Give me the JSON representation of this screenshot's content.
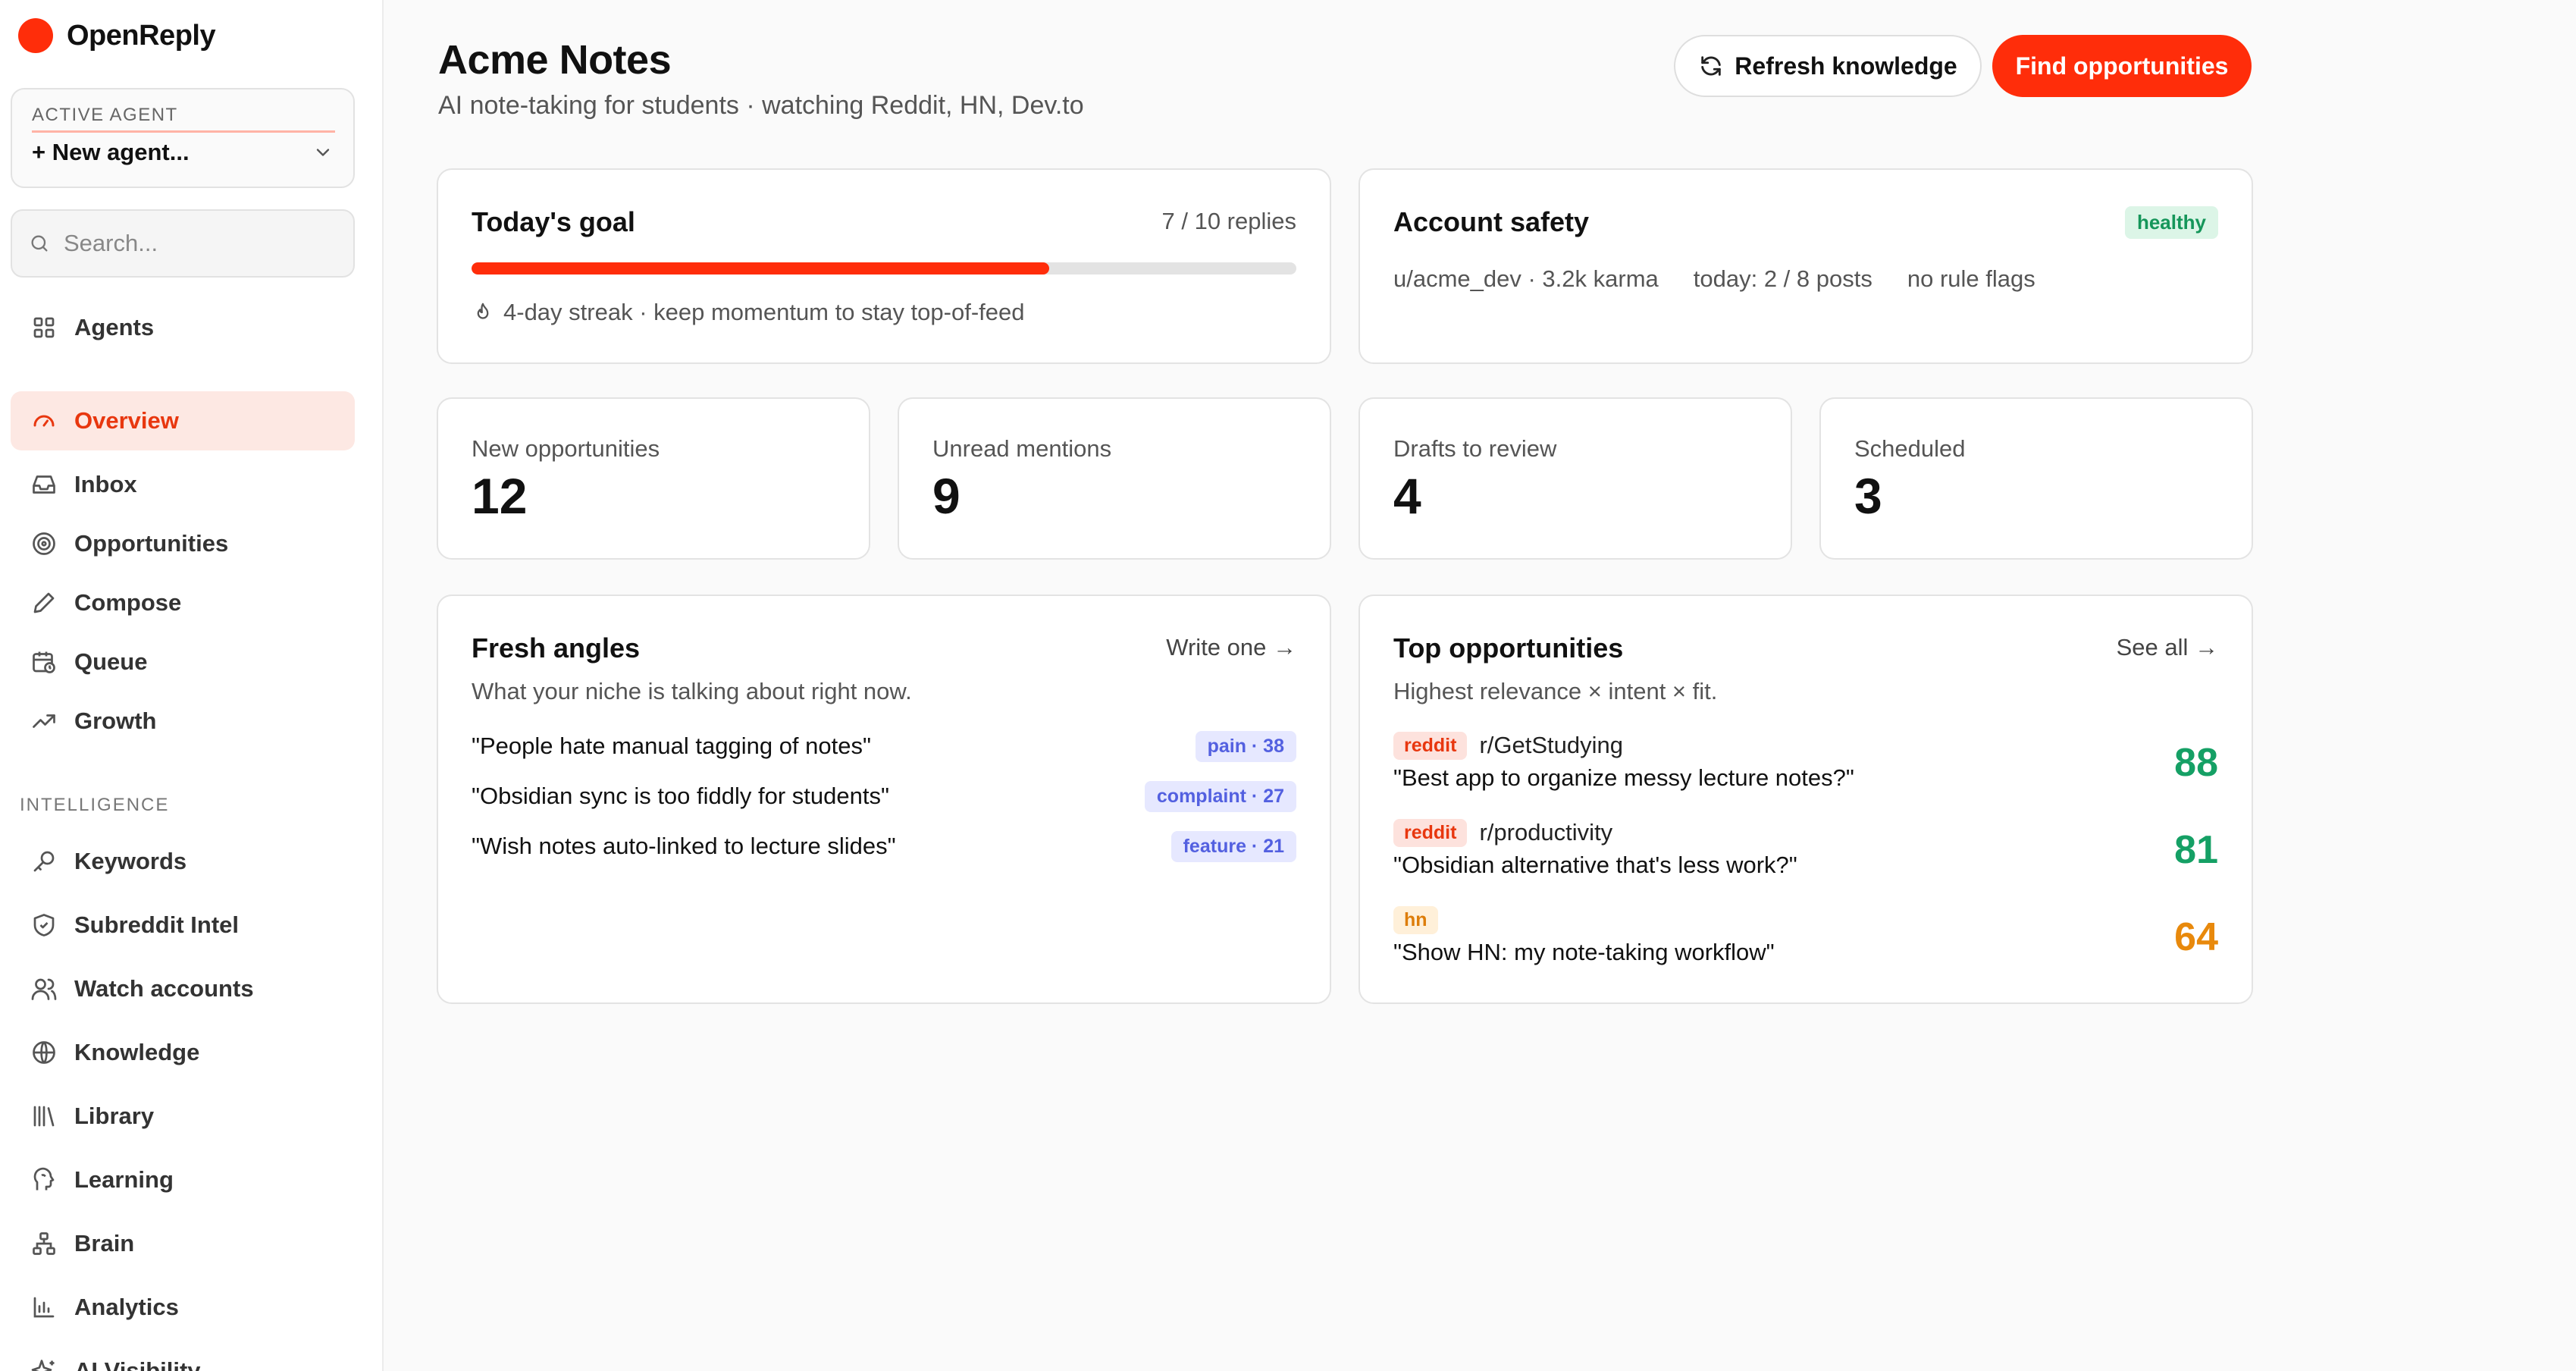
{
  "app": {
    "name": "OpenReply",
    "brand_color": "#ff2d0a"
  },
  "agent": {
    "label": "ACTIVE AGENT",
    "value": "+ New agent..."
  },
  "search": {
    "placeholder": "Search..."
  },
  "nav": {
    "top": [
      {
        "label": "Agents",
        "icon": "grid-icon"
      }
    ],
    "main": [
      {
        "label": "Overview",
        "icon": "gauge-icon",
        "active": true
      },
      {
        "label": "Inbox",
        "icon": "inbox-icon"
      },
      {
        "label": "Opportunities",
        "icon": "target-icon"
      },
      {
        "label": "Compose",
        "icon": "pen-icon"
      },
      {
        "label": "Queue",
        "icon": "calendar-clock-icon"
      },
      {
        "label": "Growth",
        "icon": "trend-up-icon"
      }
    ],
    "intelligence_label": "INTELLIGENCE",
    "intelligence": [
      {
        "label": "Keywords",
        "icon": "key-icon"
      },
      {
        "label": "Subreddit Intel",
        "icon": "shield-icon"
      },
      {
        "label": "Watch accounts",
        "icon": "users-icon"
      },
      {
        "label": "Knowledge",
        "icon": "globe-icon"
      },
      {
        "label": "Library",
        "icon": "library-icon"
      },
      {
        "label": "Learning",
        "icon": "brain-head-icon"
      },
      {
        "label": "Brain",
        "icon": "network-icon"
      },
      {
        "label": "Analytics",
        "icon": "bar-chart-icon"
      },
      {
        "label": "AI Visibility",
        "icon": "sparkles-icon"
      }
    ]
  },
  "header": {
    "title": "Acme Notes",
    "subtitle": "AI note-taking for students · watching Reddit, HN, Dev.to",
    "refresh_label": "Refresh knowledge",
    "find_label": "Find opportunities"
  },
  "goal": {
    "title": "Today's goal",
    "count": "7 / 10 replies",
    "progress": 0.7,
    "streak": "4-day streak · keep momentum to stay top-of-feed"
  },
  "safety": {
    "title": "Account safety",
    "badge": "healthy",
    "account": "u/acme_dev · 3.2k karma",
    "today": "today: 2 / 8 posts",
    "flags": "no rule flags"
  },
  "stats": [
    {
      "label": "New opportunities",
      "value": "12"
    },
    {
      "label": "Unread mentions",
      "value": "9"
    },
    {
      "label": "Drafts to review",
      "value": "4"
    },
    {
      "label": "Scheduled",
      "value": "3"
    }
  ],
  "angles": {
    "title": "Fresh angles",
    "link": "Write one →",
    "desc": "What your niche is talking about right now.",
    "items": [
      {
        "text": "\"People hate manual tagging of notes\"",
        "tag": "pain · 38"
      },
      {
        "text": "\"Obsidian sync is too fiddly for students\"",
        "tag": "complaint · 27"
      },
      {
        "text": "\"Wish notes auto-linked to lecture slides\"",
        "tag": "feature · 21"
      }
    ]
  },
  "top_opps": {
    "title": "Top opportunities",
    "link": "See all →",
    "desc": "Highest relevance × intent × fit.",
    "items": [
      {
        "source": "reddit",
        "sub": "r/GetStudying",
        "title": "\"Best app to organize messy lecture notes?\"",
        "score": "88",
        "score_color": "#15a065"
      },
      {
        "source": "reddit",
        "sub": "r/productivity",
        "title": "\"Obsidian alternative that's less work?\"",
        "score": "81",
        "score_color": "#15a065"
      },
      {
        "source": "hn",
        "sub": "",
        "title": "\"Show HN: my note-taking workflow\"",
        "score": "64",
        "score_color": "#e8890c"
      }
    ]
  }
}
